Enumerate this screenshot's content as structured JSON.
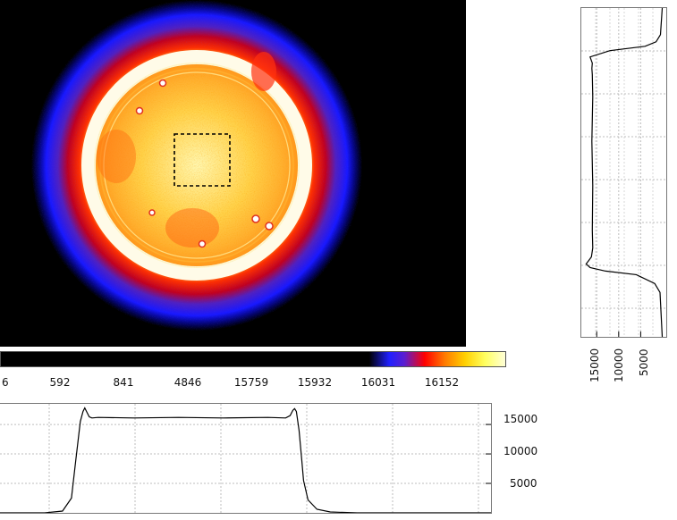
{
  "image": {
    "colormap": [
      "#000000",
      "#2020ff",
      "#ff0000",
      "#ff7a00",
      "#ffd000",
      "#ffffd8"
    ]
  },
  "colorbar": {
    "ticks": [
      "6",
      "592",
      "841",
      "4846",
      "15759",
      "15932",
      "16031",
      "16152"
    ]
  },
  "profile_bottom": {
    "ticks": [
      "15000",
      "10000",
      "5000"
    ]
  },
  "profile_right": {
    "ticks": [
      "15000",
      "10000",
      "5000"
    ]
  },
  "chart_data": [
    {
      "type": "line",
      "orientation": "horizontal",
      "title": "",
      "xlabel": "",
      "ylabel": "",
      "ylim": [
        0,
        18500
      ],
      "yticks": [
        15000,
        10000,
        5000
      ],
      "grid": true,
      "x": [
        0,
        50,
        70,
        80,
        85,
        90,
        93,
        95,
        97,
        100,
        103,
        110,
        150,
        200,
        250,
        300,
        320,
        325,
        328,
        330,
        332,
        335,
        338,
        340,
        345,
        355,
        370,
        400,
        450,
        550
      ],
      "y": [
        0,
        0,
        300,
        2500,
        9000,
        15500,
        17200,
        17800,
        17200,
        16300,
        16100,
        16200,
        16100,
        16200,
        16100,
        16200,
        16100,
        16500,
        17400,
        17700,
        17200,
        14000,
        9000,
        5500,
        2200,
        600,
        150,
        0,
        0,
        0
      ]
    },
    {
      "type": "line",
      "orientation": "vertical",
      "title": "",
      "xlabel": "",
      "ylabel": "",
      "xlim": [
        0,
        18500
      ],
      "xticks": [
        15000,
        10000,
        5000
      ],
      "grid": true,
      "x": [
        0,
        30,
        38,
        43,
        48,
        55,
        62,
        68,
        75,
        100,
        150,
        200,
        250,
        270,
        280,
        284,
        288,
        292,
        296,
        300,
        310,
        320,
        370
      ],
      "y": [
        100,
        500,
        1500,
        4000,
        12000,
        16500,
        16000,
        16100,
        16000,
        15900,
        16100,
        15900,
        16000,
        15900,
        16200,
        16800,
        17400,
        16500,
        13000,
        6000,
        1800,
        600,
        100
      ]
    }
  ]
}
